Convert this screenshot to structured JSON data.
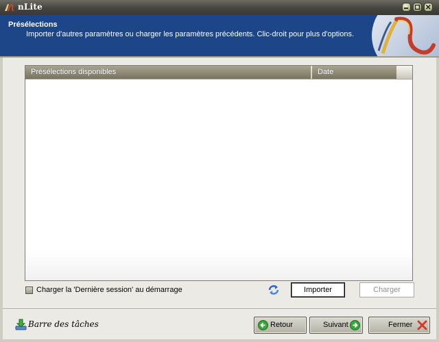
{
  "window": {
    "title": "nLite",
    "controls": [
      "minimize-icon",
      "maximize-icon",
      "close-icon"
    ]
  },
  "header": {
    "title": "Présélections",
    "description": "Importer d'autres paramètres ou charger les paramètres précédents. Clic-droit pour plus d'options.",
    "logo_icon": "nlite-logo",
    "background_color": "#1d4688"
  },
  "list": {
    "columns": [
      "Présélections disponibles",
      "Date"
    ],
    "rows": []
  },
  "options": {
    "load_last_session_label": "Charger la 'Dernière session' au démarrage",
    "load_last_session_checked": false,
    "refresh_icon": "refresh-icon"
  },
  "buttons": {
    "import_label": "Importer",
    "load_label": "Charger"
  },
  "footer": {
    "taskbar_label": "Barre des tâches",
    "taskbar_icon": "download-arrow-icon",
    "back_label": "Retour",
    "next_label": "Suivant",
    "close_label": "Fermer"
  }
}
